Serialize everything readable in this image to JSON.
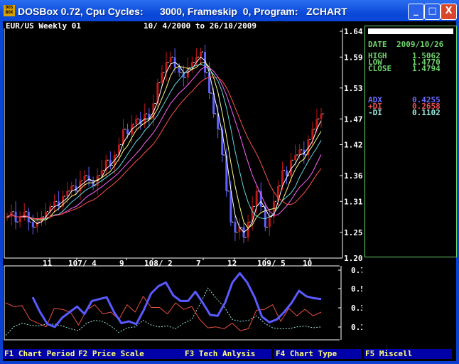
{
  "window": {
    "title": "DOSBox 0.72, Cpu Cycles:      3000, Frameskip  0, Program:   ZCHART",
    "icon_text": "DOS BOX",
    "minimize": "_",
    "maximize": "□",
    "close": "X"
  },
  "chart_header": {
    "symbol": "EUR/US Weekly 01",
    "range": "10/ 4/2000 to 26/10/2009"
  },
  "info": {
    "date_label": "DATE",
    "date": "2009/10/26",
    "high_label": "HIGH",
    "high": "1.5062",
    "low_label": "LOW",
    "low": "1.4770",
    "close_label": "CLOSE",
    "close": "1.4794",
    "adx_label": "ADX",
    "adx": "0.4255",
    "pdi_label": "+DI",
    "pdi": "0.2658",
    "mdi_label": "-DI",
    "mdi": "0.1102"
  },
  "colors": {
    "adx": "#5a5aff",
    "pdi": "#e85040",
    "mdi": "#9ee8e0",
    "up": "#c01818",
    "down": "#6060ff",
    "panel": "#6fd46f"
  },
  "chart_data": [
    {
      "type": "candlestick",
      "title": "EUR/US Weekly 01",
      "yticks": [
        "1.64",
        "1.59",
        "1.53",
        "1.47",
        "1.42",
        "1.36",
        "1.31",
        "1.25",
        "1.20"
      ],
      "ylim": [
        1.2,
        1.64
      ],
      "xticks": [
        "11",
        "107/ 4",
        "9",
        "108/ 2",
        "7",
        "12",
        "109/ 5",
        "10"
      ],
      "close": [
        1.28,
        1.29,
        1.27,
        1.28,
        1.29,
        1.27,
        1.26,
        1.27,
        1.28,
        1.29,
        1.3,
        1.31,
        1.3,
        1.32,
        1.33,
        1.34,
        1.33,
        1.35,
        1.36,
        1.35,
        1.34,
        1.36,
        1.37,
        1.39,
        1.38,
        1.4,
        1.42,
        1.45,
        1.44,
        1.46,
        1.47,
        1.46,
        1.48,
        1.47,
        1.5,
        1.54,
        1.56,
        1.58,
        1.59,
        1.57,
        1.56,
        1.55,
        1.57,
        1.58,
        1.59,
        1.6,
        1.56,
        1.52,
        1.48,
        1.45,
        1.4,
        1.33,
        1.27,
        1.25,
        1.26,
        1.24,
        1.27,
        1.3,
        1.33,
        1.3,
        1.26,
        1.28,
        1.31,
        1.34,
        1.37,
        1.36,
        1.39,
        1.4,
        1.41,
        1.4,
        1.43,
        1.45,
        1.47,
        1.48
      ]
    },
    {
      "type": "line",
      "title": "DMI",
      "yticks": [
        "0.7527",
        "0.5532",
        "0.3460",
        "0.1388"
      ],
      "ylim": [
        0.0,
        0.8
      ],
      "series": [
        {
          "name": "ADX",
          "values": [
            0.46,
            0.3,
            0.17,
            0.14,
            0.24,
            0.3,
            0.36,
            0.28,
            0.42,
            0.44,
            0.46,
            0.3,
            0.18,
            0.2,
            0.17,
            0.32,
            0.5,
            0.58,
            0.62,
            0.48,
            0.42,
            0.42,
            0.52,
            0.4,
            0.27,
            0.26,
            0.4,
            0.62,
            0.72,
            0.62,
            0.46,
            0.25,
            0.19,
            0.22,
            0.3,
            0.4,
            0.53,
            0.47,
            0.45,
            0.44
          ]
        },
        {
          "name": "+DI",
          "values": [
            0.4,
            0.36,
            0.37,
            0.22,
            0.18,
            0.14,
            0.34,
            0.33,
            0.3,
            0.16,
            0.32,
            0.38,
            0.28,
            0.3,
            0.22,
            0.38,
            0.3,
            0.47,
            0.35,
            0.35,
            0.28,
            0.4,
            0.33,
            0.36,
            0.22,
            0.13,
            0.14,
            0.12,
            0.18,
            0.1,
            0.12,
            0.32,
            0.33,
            0.38,
            0.2,
            0.34,
            0.26,
            0.33,
            0.26,
            0.3
          ]
        },
        {
          "name": "-DI",
          "values": [
            0.05,
            0.14,
            0.18,
            0.16,
            0.15,
            0.17,
            0.17,
            0.15,
            0.12,
            0.1,
            0.18,
            0.21,
            0.2,
            0.15,
            0.08,
            0.13,
            0.14,
            0.21,
            0.16,
            0.14,
            0.15,
            0.12,
            0.18,
            0.22,
            0.38,
            0.56,
            0.45,
            0.36,
            0.22,
            0.2,
            0.21,
            0.26,
            0.18,
            0.13,
            0.12,
            0.12,
            0.14,
            0.15,
            0.13,
            0.14
          ]
        }
      ]
    }
  ],
  "menu": [
    "F1 Chart Period",
    "F2 Price Scale",
    "F3 Tech Anlysis",
    "F4 Chart Type",
    "F5 Miscell"
  ]
}
